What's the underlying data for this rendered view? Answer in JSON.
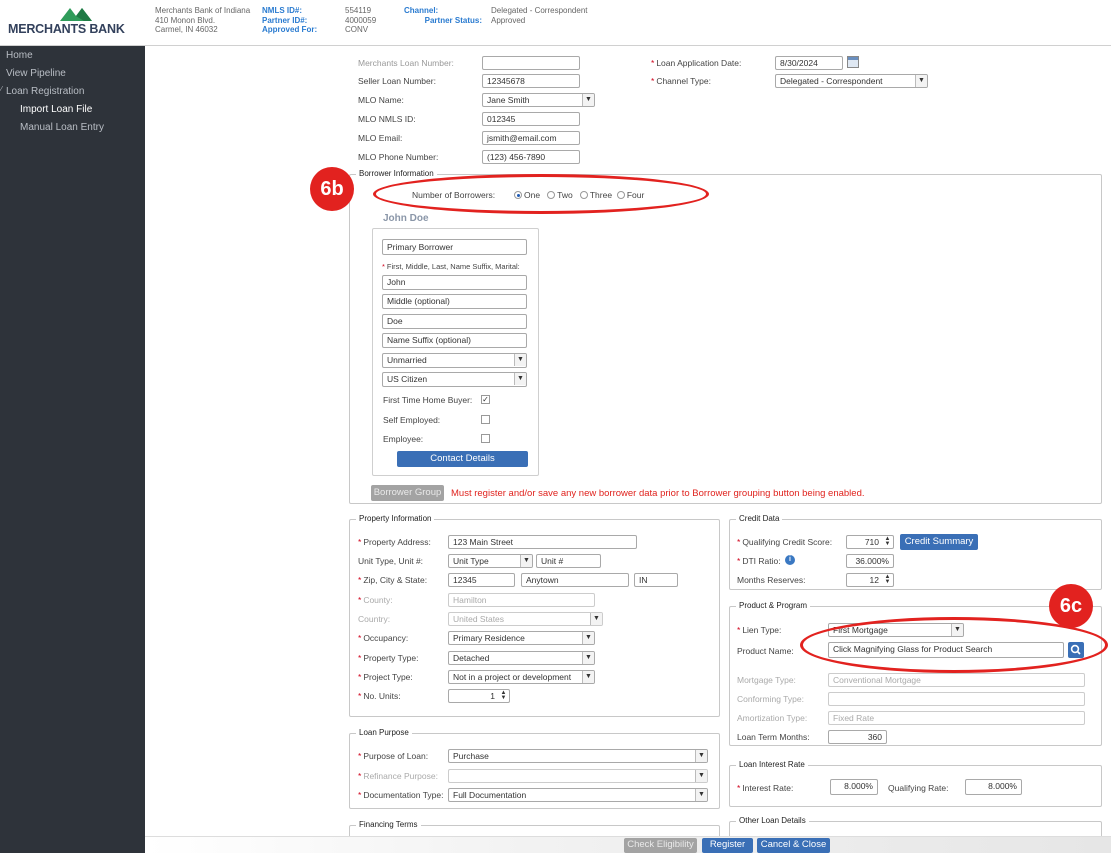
{
  "header": {
    "logo_text": "MERCHANTS BANK",
    "company_name": "Merchants Bank of Indiana",
    "address1": "410 Monon Blvd.",
    "address2": "Carmel, IN 46032",
    "nmls_label": "NMLS ID#:",
    "nmls_value": "554119",
    "partner_label": "Partner ID#:",
    "partner_value": "4000059",
    "approved_label": "Approved For:",
    "approved_value": "CONV",
    "channel_label": "Channel:",
    "channel_value": "Delegated - Correspondent",
    "status_label": "Partner Status:",
    "status_value": "Approved"
  },
  "sidebar": {
    "items": [
      {
        "label": "Home"
      },
      {
        "label": "View Pipeline"
      },
      {
        "label": "Loan Registration"
      },
      {
        "label": "Import Loan File"
      },
      {
        "label": "Manual Loan Entry"
      }
    ]
  },
  "loan_info": {
    "merchants_loan_number_label": "Merchants Loan Number:",
    "merchants_loan_number_value": "",
    "seller_loan_number_label": "Seller Loan Number:",
    "seller_loan_number_value": "12345678",
    "mlo_name_label": "MLO Name:",
    "mlo_name_value": "Jane Smith",
    "mlo_nmls_label": "MLO NMLS ID:",
    "mlo_nmls_value": "012345",
    "mlo_email_label": "MLO Email:",
    "mlo_email_value": "jsmith@email.com",
    "mlo_phone_label": "MLO Phone Number:",
    "mlo_phone_value": "(123) 456-7890",
    "app_date_label": "Loan Application Date:",
    "app_date_value": "8/30/2024",
    "channel_type_label": "Channel Type:",
    "channel_type_value": "Delegated - Correspondent"
  },
  "borrower": {
    "section_title": "Borrower Information",
    "num_borrowers_label": "Number of Borrowers:",
    "options": [
      "One",
      "Two",
      "Three",
      "Four"
    ],
    "selected": "One",
    "name_heading": "John Doe",
    "type_value": "Primary Borrower",
    "name_fields_label": "First, Middle, Last, Name Suffix, Marital:",
    "first_value": "John",
    "middle_placeholder": "Middle (optional)",
    "last_value": "Doe",
    "suffix_placeholder": "Name Suffix (optional)",
    "marital_value": "Unmarried",
    "citizenship_value": "US Citizen",
    "first_time_label": "First Time Home Buyer:",
    "self_employed_label": "Self Employed:",
    "employee_label": "Employee:",
    "contact_button": "Contact Details",
    "group_button": "Borrower Group",
    "warning": "Must register and/or save any new borrower data prior to Borrower grouping button being enabled."
  },
  "property": {
    "section_title": "Property Information",
    "address_label": "Property Address:",
    "address_value": "123 Main Street",
    "unit_label": "Unit Type, Unit #:",
    "unit_type_value": "Unit Type",
    "unit_num_placeholder": "Unit #",
    "zip_label": "Zip, City & State:",
    "zip_value": "12345",
    "city_value": "Anytown",
    "state_value": "IN",
    "county_label": "County:",
    "county_value": "Hamilton",
    "country_label": "Country:",
    "country_value": "United States",
    "occupancy_label": "Occupancy:",
    "occupancy_value": "Primary Residence",
    "property_type_label": "Property Type:",
    "property_type_value": "Detached",
    "project_type_label": "Project Type:",
    "project_type_value": "Not in a project or development",
    "units_label": "No. Units:",
    "units_value": "1"
  },
  "credit": {
    "section_title": "Credit Data",
    "score_label": "Qualifying Credit Score:",
    "score_value": "710",
    "summary_button": "Credit Summary",
    "dti_label": "DTI Ratio:",
    "dti_value": "36.000%",
    "reserves_label": "Months Reserves:",
    "reserves_value": "12"
  },
  "product": {
    "section_title": "Product & Program",
    "lien_label": "Lien Type:",
    "lien_value": "First Mortgage",
    "product_label": "Product Name:",
    "product_value": "Click Magnifying Glass for Product Search",
    "mortgage_type_label": "Mortgage Type:",
    "mortgage_type_value": "Conventional Mortgage",
    "conforming_label": "Conforming Type:",
    "conforming_value": "",
    "amortization_label": "Amortization Type:",
    "amortization_value": "Fixed Rate",
    "term_label": "Loan Term Months:",
    "term_value": "360"
  },
  "purpose": {
    "section_title": "Loan Purpose",
    "purpose_label": "Purpose of Loan:",
    "purpose_value": "Purchase",
    "refi_label": "Refinance Purpose:",
    "refi_value": "",
    "doc_label": "Documentation Type:",
    "doc_value": "Full Documentation"
  },
  "rate": {
    "section_title": "Loan Interest Rate",
    "interest_label": "Interest Rate:",
    "interest_value": "8.000%",
    "qualifying_label": "Qualifying Rate:",
    "qualifying_value": "8.000%"
  },
  "financing": {
    "section_title": "Financing Terms"
  },
  "other": {
    "section_title": "Other Loan Details"
  },
  "footer": {
    "check_button": "Check Eligibility",
    "register_button": "Register",
    "cancel_button": "Cancel & Close"
  },
  "callouts": {
    "b": "6b",
    "c": "6c"
  },
  "colors": {
    "accent": "#3a6fb6",
    "callout": "#e2221f",
    "sidebar": "#2e333a",
    "logo": "#2f9c5a"
  }
}
